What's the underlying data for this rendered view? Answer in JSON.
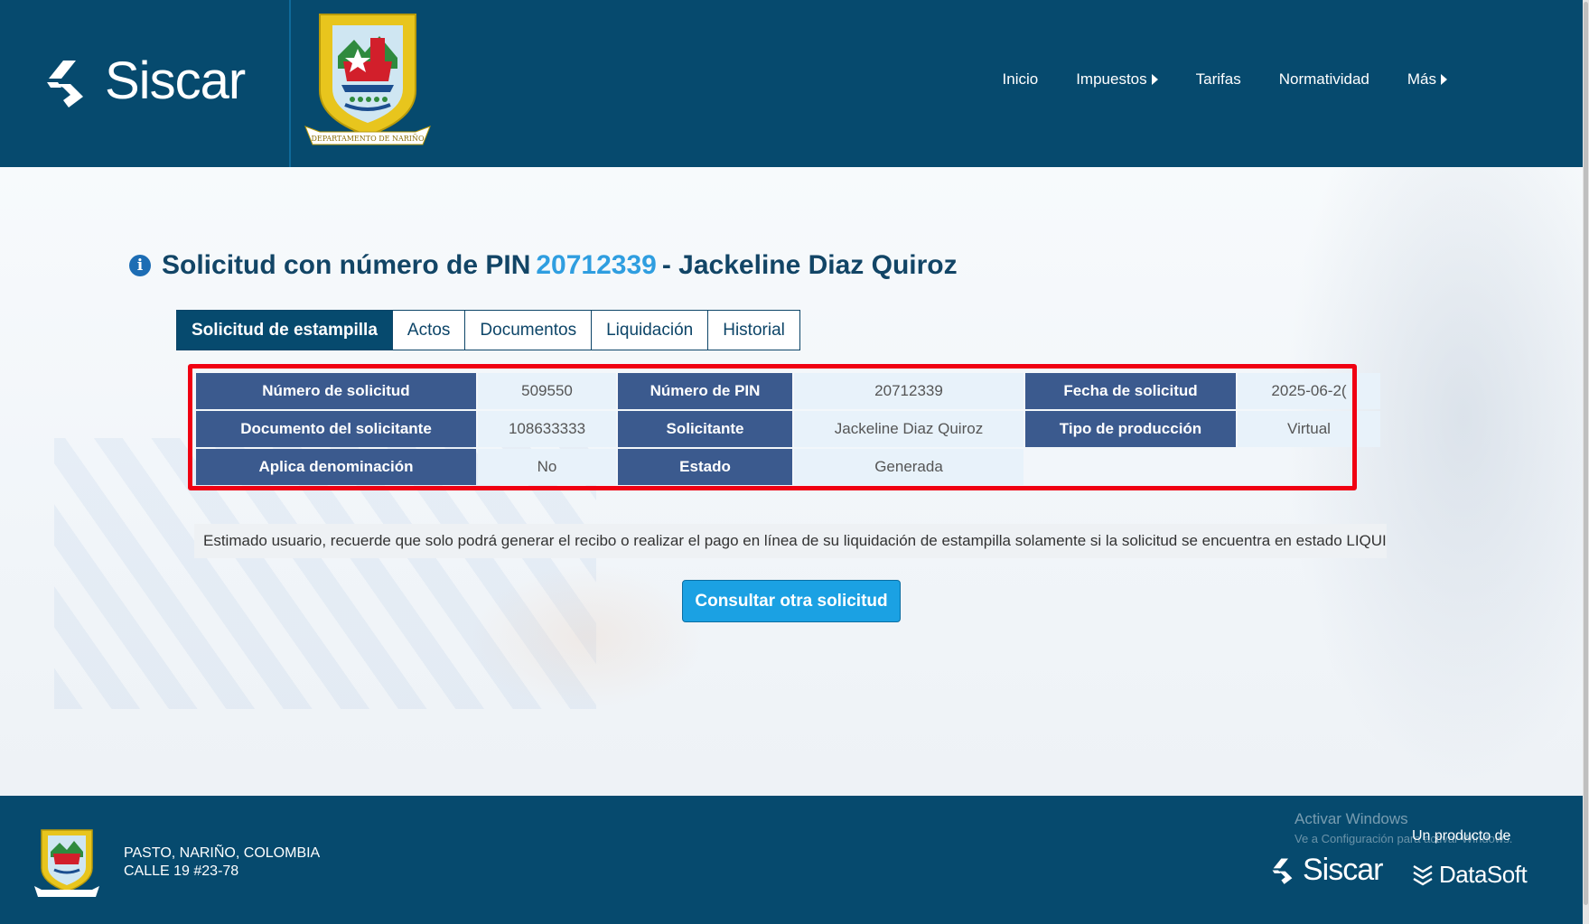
{
  "header": {
    "logo_text": "Siscar",
    "crest_caption": "DEPARTAMENTO DE NARIÑO",
    "nav": [
      {
        "label": "Inicio",
        "has_caret": false
      },
      {
        "label": "Impuestos",
        "has_caret": true
      },
      {
        "label": "Tarifas",
        "has_caret": false
      },
      {
        "label": "Normatividad",
        "has_caret": false
      },
      {
        "label": "Más",
        "has_caret": true
      }
    ]
  },
  "title": {
    "prefix": "Solicitud con número de PIN",
    "pin": "20712339",
    "suffix": "- Jackeline Diaz Quiroz",
    "icon": "info-icon"
  },
  "tabs": [
    {
      "label": "Solicitud de estampilla",
      "active": true
    },
    {
      "label": "Actos",
      "active": false
    },
    {
      "label": "Documentos",
      "active": false
    },
    {
      "label": "Liquidación",
      "active": false
    },
    {
      "label": "Historial",
      "active": false
    }
  ],
  "details": {
    "numero_solicitud_label": "Número de solicitud",
    "numero_solicitud": "509550",
    "numero_pin_label": "Número de PIN",
    "numero_pin": "20712339",
    "fecha_solicitud_label": "Fecha de solicitud",
    "fecha_solicitud": "2025-06-2(",
    "documento_label": "Documento del solicitante",
    "documento": "108633333",
    "solicitante_label": "Solicitante",
    "solicitante": "Jackeline Diaz Quiroz",
    "tipo_produccion_label": "Tipo de producción",
    "tipo_produccion": "Virtual",
    "aplica_denominacion_label": "Aplica denominación",
    "aplica_denominacion": "No",
    "estado_label": "Estado",
    "estado": "Generada"
  },
  "notice": "Estimado usuario, recuerde que solo podrá generar el recibo o realizar el pago en línea de su liquidación de estampilla solamente si la solicitud se encuentra en estado LIQUIDADA",
  "consult_button": "Consultar otra solicitud",
  "footer": {
    "address_line1": "PASTO, NARIÑO, COLOMBIA",
    "address_line2": "CALLE 19 #23-78",
    "activate_title": "Activar Windows",
    "activate_sub": "Ve a Configuración para activar Windows.",
    "producto": "Un producto de",
    "siscar_logo": "Siscar",
    "datasoft_logo": "DataSoft"
  },
  "colors": {
    "header_bg": "#064a6e",
    "label_bg": "#3b5a8e",
    "value_bg": "#e8f2fa",
    "accent_pin": "#2f9ee0",
    "button_bg": "#1ba1e3",
    "highlight": "#f00012"
  }
}
